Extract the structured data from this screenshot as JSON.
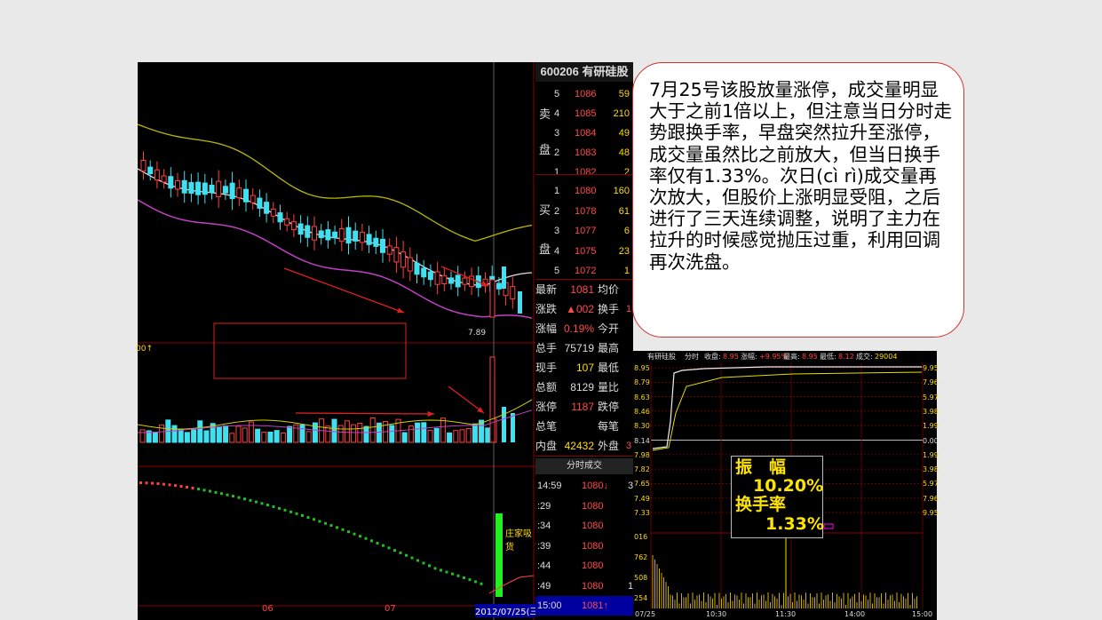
{
  "stock": {
    "code_name": "600206 有研硅股"
  },
  "ask": {
    "label_top": "卖",
    "label_bottom": "盘",
    "rows": [
      {
        "level": "5",
        "price": "1086",
        "vol": "59"
      },
      {
        "level": "4",
        "price": "1085",
        "vol": "210"
      },
      {
        "level": "3",
        "price": "1084",
        "vol": "49"
      },
      {
        "level": "2",
        "price": "1083",
        "vol": "48"
      },
      {
        "level": "1",
        "price": "1082",
        "vol": "2"
      }
    ]
  },
  "bid": {
    "label_top": "买",
    "label_bottom": "盘",
    "rows": [
      {
        "level": "1",
        "price": "1080",
        "vol": "160"
      },
      {
        "level": "2",
        "price": "1078",
        "vol": "61"
      },
      {
        "level": "3",
        "price": "1077",
        "vol": "6"
      },
      {
        "level": "4",
        "price": "1075",
        "vol": "23"
      },
      {
        "level": "5",
        "price": "1072",
        "vol": "1"
      }
    ]
  },
  "stats": [
    {
      "k": "最新",
      "v": "1081",
      "k2": "均价",
      "v2": ""
    },
    {
      "k": "涨跌",
      "v": "▲002",
      "k2": "换手",
      "v2": "1"
    },
    {
      "k": "涨幅",
      "v": "0.19%",
      "k2": "今开",
      "v2": ""
    },
    {
      "k": "总手",
      "v": "75719",
      "k2": "最高",
      "v2": ""
    },
    {
      "k": "现手",
      "v": "107",
      "k2": "最低",
      "v2": ""
    },
    {
      "k": "总额",
      "v": "8129",
      "k2": "量比",
      "v2": ""
    },
    {
      "k": "涨停",
      "v": "1187",
      "k2": "跌停",
      "v2": ""
    },
    {
      "k": "总笔",
      "v": "",
      "k2": "每笔",
      "v2": ""
    },
    {
      "k": "内盘",
      "v": "42432",
      "k2": "外盘",
      "v2": "3"
    }
  ],
  "trades": {
    "header": "分时成交",
    "rows": [
      {
        "t": "14:59",
        "p": "1080↓",
        "n": "3"
      },
      {
        "t": ":29",
        "p": "1080",
        "n": ""
      },
      {
        "t": ":34",
        "p": "1080",
        "n": ""
      },
      {
        "t": ":39",
        "p": "1080",
        "n": ""
      },
      {
        "t": ":44",
        "p": "1080",
        "n": ""
      },
      {
        "t": ":49",
        "p": "1080",
        "n": "1"
      },
      {
        "t": "15:00",
        "p": "1081↑",
        "n": ""
      }
    ]
  },
  "kchart": {
    "low_label": "7.89",
    "ind_label": "庄家吸货",
    "vol_label": "00↑",
    "dates": [
      "06",
      "07",
      "2012/07/25(三)"
    ]
  },
  "callout": {
    "text": "7月25号该股放量涨停，成交量明显大于之前1倍以上，但注意当日分时走势跟换手率，早盘突然拉升至涨停，成交量虽然比之前放大，但当日换手率仅有1.33%。次日(cì rì)成交量再次放大，但股价上涨明显受阻，之后进行了三天连续调整，说明了主力在拉升的时候感觉抛压过重，利用回调再次洗盘。"
  },
  "intraday": {
    "header": {
      "name": "有研硅股",
      "mode": "分时",
      "close_label": "收盘:",
      "close": "8.95",
      "change_label": "涨幅:",
      "change": "+9.95%",
      "high_label": "最高:",
      "high": "8.95",
      "low_label": "最低:",
      "low": "8.12",
      "vol_label": "成交:",
      "vol": "29004"
    },
    "left_axis": [
      "8.95",
      "8.79",
      "8.63",
      "8.46",
      "8.30",
      "8.14",
      "7.98",
      "7.82",
      "7.65",
      "7.49",
      "7.33"
    ],
    "right_axis": [
      "9.95",
      "7.96",
      "5.97",
      "3.98",
      "1.99",
      "0.00",
      "1.99",
      "3.98",
      "5.97",
      "7.96",
      "9.95"
    ],
    "vol_axis": [
      "016",
      "762",
      "508",
      "254"
    ],
    "times": [
      "07/25",
      "10:30",
      "11:30",
      "14:00",
      "15:00"
    ],
    "amplitude_label": "振　幅",
    "amplitude": "10.20%",
    "turnover_label": "换手率",
    "turnover": "1.33%"
  }
}
